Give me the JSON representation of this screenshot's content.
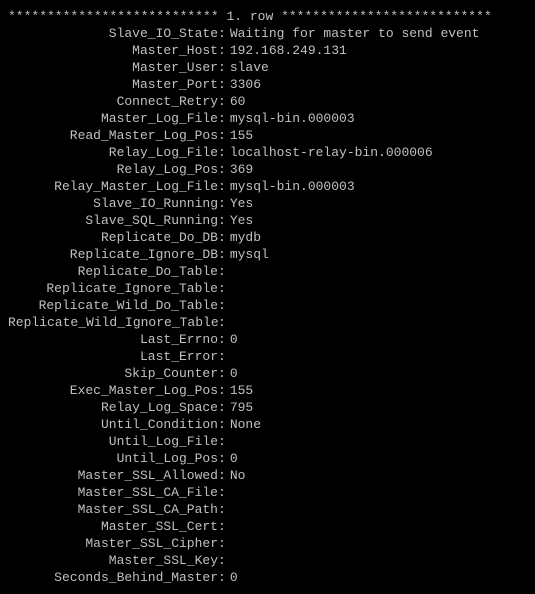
{
  "header": {
    "left_stars": "***************************",
    "label": " 1. row ",
    "right_stars": "***************************"
  },
  "rows": [
    {
      "label": "Slave_IO_State",
      "value": "Waiting for master to send event"
    },
    {
      "label": "Master_Host",
      "value": "192.168.249.131"
    },
    {
      "label": "Master_User",
      "value": "slave"
    },
    {
      "label": "Master_Port",
      "value": "3306"
    },
    {
      "label": "Connect_Retry",
      "value": "60"
    },
    {
      "label": "Master_Log_File",
      "value": "mysql-bin.000003"
    },
    {
      "label": "Read_Master_Log_Pos",
      "value": "155"
    },
    {
      "label": "Relay_Log_File",
      "value": "localhost-relay-bin.000006"
    },
    {
      "label": "Relay_Log_Pos",
      "value": "369"
    },
    {
      "label": "Relay_Master_Log_File",
      "value": "mysql-bin.000003"
    },
    {
      "label": "Slave_IO_Running",
      "value": "Yes"
    },
    {
      "label": "Slave_SQL_Running",
      "value": "Yes"
    },
    {
      "label": "Replicate_Do_DB",
      "value": "mydb"
    },
    {
      "label": "Replicate_Ignore_DB",
      "value": "mysql"
    },
    {
      "label": "Replicate_Do_Table",
      "value": ""
    },
    {
      "label": "Replicate_Ignore_Table",
      "value": ""
    },
    {
      "label": "Replicate_Wild_Do_Table",
      "value": ""
    },
    {
      "label": "Replicate_Wild_Ignore_Table",
      "value": ""
    },
    {
      "label": "Last_Errno",
      "value": "0"
    },
    {
      "label": "Last_Error",
      "value": ""
    },
    {
      "label": "Skip_Counter",
      "value": "0"
    },
    {
      "label": "Exec_Master_Log_Pos",
      "value": "155"
    },
    {
      "label": "Relay_Log_Space",
      "value": "795"
    },
    {
      "label": "Until_Condition",
      "value": "None"
    },
    {
      "label": "Until_Log_File",
      "value": ""
    },
    {
      "label": "Until_Log_Pos",
      "value": "0"
    },
    {
      "label": "Master_SSL_Allowed",
      "value": "No"
    },
    {
      "label": "Master_SSL_CA_File",
      "value": ""
    },
    {
      "label": "Master_SSL_CA_Path",
      "value": ""
    },
    {
      "label": "Master_SSL_Cert",
      "value": ""
    },
    {
      "label": "Master_SSL_Cipher",
      "value": ""
    },
    {
      "label": "Master_SSL_Key",
      "value": ""
    },
    {
      "label": "Seconds_Behind_Master",
      "value": "0"
    }
  ]
}
